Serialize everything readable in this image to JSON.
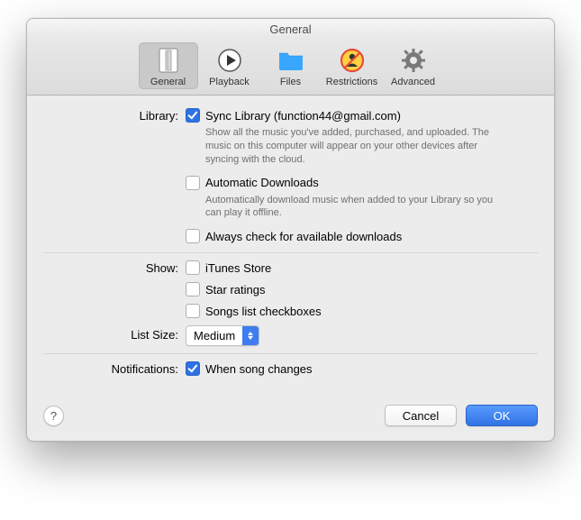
{
  "title": "General",
  "tabs": {
    "general": "General",
    "playback": "Playback",
    "files": "Files",
    "restrictions": "Restrictions",
    "advanced": "Advanced"
  },
  "library": {
    "label": "Library:",
    "sync": {
      "checked": true,
      "label": "Sync Library (function44@gmail.com)",
      "desc": "Show all the music you've added, purchased, and uploaded. The music on this computer will appear on your other devices after syncing with the cloud."
    },
    "autoDownloads": {
      "checked": false,
      "label": "Automatic Downloads",
      "desc": "Automatically download music when added to your Library so you can play it offline."
    },
    "alwaysCheck": {
      "checked": false,
      "label": "Always check for available downloads"
    }
  },
  "show": {
    "label": "Show:",
    "itunes": {
      "checked": false,
      "label": "iTunes Store"
    },
    "star": {
      "checked": false,
      "label": "Star ratings"
    },
    "checks": {
      "checked": false,
      "label": "Songs list checkboxes"
    }
  },
  "listSize": {
    "label": "List Size:",
    "value": "Medium"
  },
  "notifications": {
    "label": "Notifications:",
    "songChanges": {
      "checked": true,
      "label": "When song changes"
    }
  },
  "buttons": {
    "help": "?",
    "cancel": "Cancel",
    "ok": "OK"
  }
}
